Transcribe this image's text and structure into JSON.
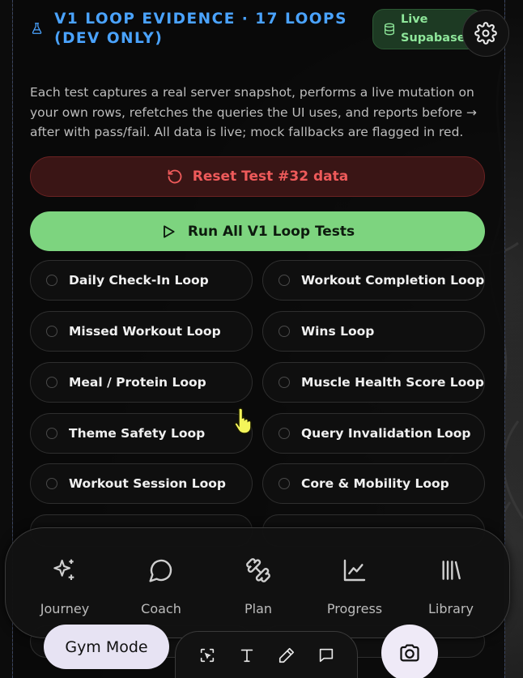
{
  "header": {
    "title": "V1 LOOP EVIDENCE · 17 LOOPS (DEV ONLY)",
    "badge_line1": "Live",
    "badge_line2": "Supabase"
  },
  "description": "Each test captures a real server snapshot, performs a live mutation on your own rows, refetches the queries the UI uses, and reports before → after with pass/fail. All data is live; mock fallbacks are flagged in red.",
  "reset_button_label": "Reset Test #32 data",
  "run_button_label": "Run All V1 Loop Tests",
  "loops": [
    "Daily Check-In Loop",
    "Workout Completion Loop",
    "Missed Workout Loop",
    "Wins Loop",
    "Meal / Protein Loop",
    "Muscle Health Score Loop",
    "Theme Safety Loop",
    "Query Invalidation Loop",
    "Workout Session Loop",
    "Core & Mobility Loop"
  ],
  "nav": {
    "items": [
      {
        "label": "Journey",
        "icon": "sparkles-icon"
      },
      {
        "label": "Coach",
        "icon": "chat-bubble-icon"
      },
      {
        "label": "Plan",
        "icon": "dumbbell-icon"
      },
      {
        "label": "Progress",
        "icon": "line-chart-icon"
      },
      {
        "label": "Library",
        "icon": "library-icon"
      }
    ]
  },
  "gym_mode_label": "Gym Mode",
  "colors": {
    "accent_blue": "#4aa3ff",
    "run_green": "#7dd47f",
    "reset_red": "#ee5a5a",
    "live_green": "#8ee69a"
  }
}
